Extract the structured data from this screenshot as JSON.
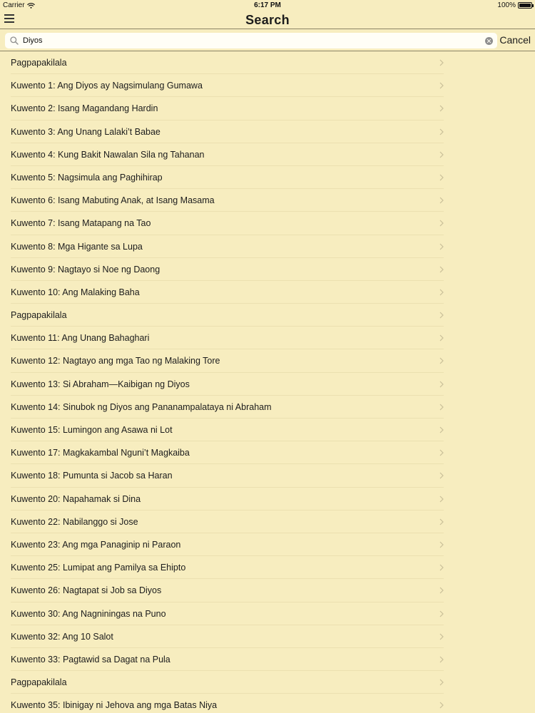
{
  "status_bar": {
    "carrier": "Carrier",
    "time": "6:17 PM",
    "battery": "100%",
    "battery_level": 1.0
  },
  "nav": {
    "title": "Search",
    "menu_icon": "hamburger-menu-icon"
  },
  "search": {
    "value": "Diyos",
    "placeholder": "",
    "cancel_label": "Cancel"
  },
  "results": [
    "Pagpapakilala",
    "Kuwento 1: Ang Diyos ay Nagsimulang Gumawa",
    "Kuwento 2: Isang Magandang Hardin",
    "Kuwento 3: Ang Unang Lalaki’t Babae",
    "Kuwento 4: Kung Bakit Nawalan Sila ng Tahanan",
    "Kuwento 5: Nagsimula ang Paghihirap",
    "Kuwento 6: Isang Mabuting Anak, at Isang Masama",
    "Kuwento 7: Isang Matapang na Tao",
    "Kuwento 8: Mga Higante sa Lupa",
    "Kuwento 9: Nagtayo si Noe ng Daong",
    "Kuwento 10: Ang Malaking Baha",
    "Pagpapakilala",
    "Kuwento 11: Ang Unang Bahaghari",
    "Kuwento 12: Nagtayo ang mga Tao ng Malaking Tore",
    "Kuwento 13: Si Abraham—Kaibigan ng Diyos",
    "Kuwento 14: Sinubok ng Diyos ang Pananampalataya ni Abraham",
    "Kuwento 15: Lumingon ang Asawa ni Lot",
    "Kuwento 17: Magkakambal Nguni’t Magkaiba",
    "Kuwento 18: Pumunta si Jacob sa Haran",
    "Kuwento 20: Napahamak si Dina",
    "Kuwento 22: Nabilanggo si Jose",
    "Kuwento 23: Ang mga Panaginip ni Paraon",
    "Kuwento 25: Lumipat ang Pamilya sa Ehipto",
    "Kuwento 26: Nagtapat si Job sa Diyos",
    "Kuwento 30: Ang Nagniningas na Puno",
    "Kuwento 32: Ang 10 Salot",
    "Kuwento 33: Pagtawid sa Dagat na Pula",
    "Pagpapakilala",
    "Kuwento 35: Ibinigay ni Jehova ang mga Batas Niya"
  ],
  "colors": {
    "background": "#f7edbf",
    "separator": "#8c8466",
    "row_divider": "#ebe0b0",
    "chevron": "#c9bf98"
  }
}
